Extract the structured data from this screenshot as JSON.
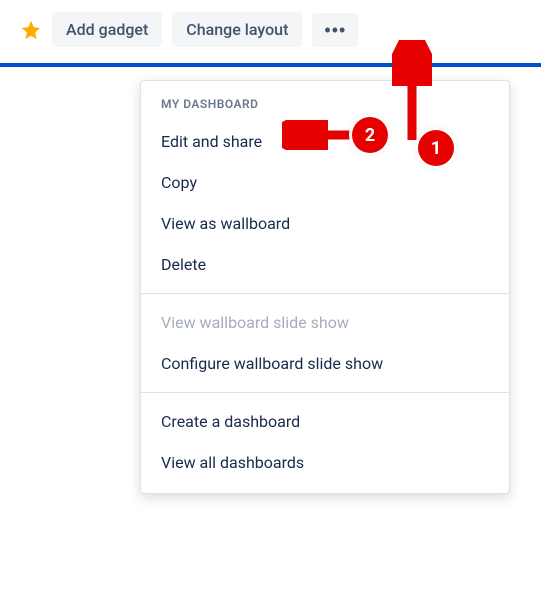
{
  "toolbar": {
    "add_gadget_label": "Add gadget",
    "change_layout_label": "Change layout"
  },
  "dropdown": {
    "section_header": "MY DASHBOARD",
    "groups": [
      [
        {
          "label": "Edit and share",
          "disabled": false
        },
        {
          "label": "Copy",
          "disabled": false
        },
        {
          "label": "View as wallboard",
          "disabled": false
        },
        {
          "label": "Delete",
          "disabled": false
        }
      ],
      [
        {
          "label": "View wallboard slide show",
          "disabled": true
        },
        {
          "label": "Configure wallboard slide show",
          "disabled": false
        }
      ],
      [
        {
          "label": "Create a dashboard",
          "disabled": false
        },
        {
          "label": "View all dashboards",
          "disabled": false
        }
      ]
    ]
  },
  "annotations": {
    "step1": "1",
    "step2": "2"
  }
}
